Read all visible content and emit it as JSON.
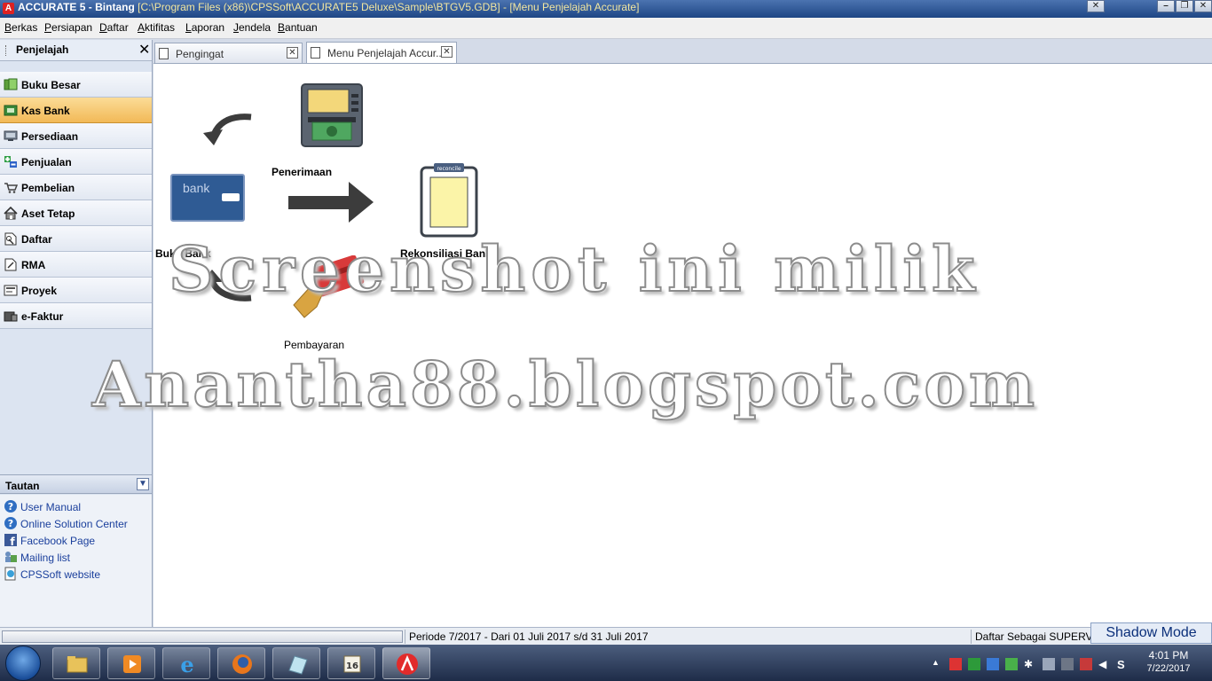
{
  "window": {
    "app_name": "ACCURATE 5",
    "title_sep": " - Bintang",
    "path": "   [C:\\Program Files (x86)\\CPSSoft\\ACCURATE5 Deluxe\\Sample\\BTGV5.GDB] - [Menu Penjelajah Accurate]"
  },
  "menubar": [
    {
      "ul": "B",
      "rest": "erkas"
    },
    {
      "ul": "P",
      "rest": "ersiapan"
    },
    {
      "ul": "D",
      "rest": "aftar"
    },
    {
      "ul": "A",
      "rest": "ktifitas"
    },
    {
      "ul": "L",
      "rest": "aporan"
    },
    {
      "ul": "J",
      "rest": "endela"
    },
    {
      "ul": "B",
      "rest": "antuan"
    }
  ],
  "explorer": {
    "title": "Penjelajah",
    "close": "✕",
    "items": [
      {
        "label": "Buku Besar",
        "icon": "ledger-icon"
      },
      {
        "label": "Kas Bank",
        "icon": "bank-icon"
      },
      {
        "label": "Persediaan",
        "icon": "inventory-icon"
      },
      {
        "label": "Penjualan",
        "icon": "sales-icon"
      },
      {
        "label": "Pembelian",
        "icon": "cart-icon"
      },
      {
        "label": "Aset Tetap",
        "icon": "house-icon"
      },
      {
        "label": "Daftar",
        "icon": "list-icon"
      },
      {
        "label": "RMA",
        "icon": "rma-icon"
      },
      {
        "label": "Proyek",
        "icon": "project-icon"
      },
      {
        "label": "e-Faktur",
        "icon": "efaktur-icon"
      }
    ],
    "active_index": 1
  },
  "tautan": {
    "title": "Tautan",
    "chevron": "⌄",
    "links": [
      {
        "label": "User Manual",
        "icon": "help-icon"
      },
      {
        "label": "Online Solution Center",
        "icon": "help-icon"
      },
      {
        "label": "Facebook Page",
        "icon": "facebook-icon"
      },
      {
        "label": "Mailing list",
        "icon": "mailing-list-icon"
      },
      {
        "label": "CPSSoft website",
        "icon": "website-icon"
      }
    ]
  },
  "tabs": [
    {
      "label": "Pengingat",
      "close": "✕"
    },
    {
      "label": "Menu Penjelajah Accur...",
      "close": "✕"
    }
  ],
  "diagram": {
    "buku_bank": "Buku Bank",
    "penerimaan": "Penerimaan",
    "rekonsiliasi": "Rekonsiliasi Bank",
    "pembayaran": "Pembayaran",
    "bank_card_text": "bank",
    "reconcile_text": "reconcile"
  },
  "watermark": {
    "line1": "Screenshot ini milik",
    "line2": "Anantha88.blogspot.com"
  },
  "status": {
    "periode": "Periode 7/2017 - Dari 01 Juli 2017 s/d 31 Juli 2017",
    "user": "Daftar Sebagai SUPERVIS",
    "shadow_mode": "Shadow Mode"
  },
  "clock": {
    "time": "4:01 PM",
    "date": "7/22/2017"
  },
  "taskbar_calendar_day": "16"
}
